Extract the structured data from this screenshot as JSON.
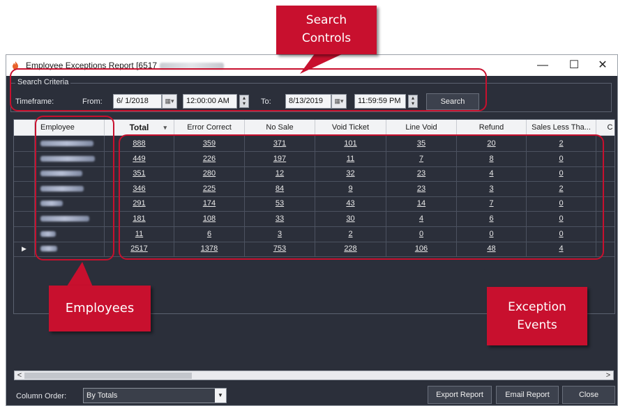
{
  "window": {
    "title": "Employee Exceptions Report [6517",
    "title_suffix_redacted": "- Jacksonville, FL]",
    "minimize": "—",
    "maximize": "☐",
    "close": "✕"
  },
  "criteria": {
    "legend": "Search Criteria",
    "timeframe_label": "Timeframe:",
    "from_label": "From:",
    "from_date": "6/ 1/2018",
    "from_time": "12:00:00 AM",
    "to_label": "To:",
    "to_date": "8/13/2019",
    "to_time": "11:59:59 PM",
    "search_button": "Search"
  },
  "grid": {
    "columns": [
      "Employee",
      "Total",
      "Error Correct",
      "No Sale",
      "Void Ticket",
      "Line Void",
      "Refund",
      "Sales Less Tha...",
      "C"
    ],
    "rows": [
      {
        "values": [
          "888",
          "359",
          "371",
          "101",
          "35",
          "20",
          "2"
        ]
      },
      {
        "values": [
          "449",
          "226",
          "197",
          "11",
          "7",
          "8",
          "0"
        ]
      },
      {
        "values": [
          "351",
          "280",
          "12",
          "32",
          "23",
          "4",
          "0"
        ]
      },
      {
        "values": [
          "346",
          "225",
          "84",
          "9",
          "23",
          "3",
          "2"
        ]
      },
      {
        "values": [
          "291",
          "174",
          "53",
          "43",
          "14",
          "7",
          "0"
        ]
      },
      {
        "values": [
          "181",
          "108",
          "33",
          "30",
          "4",
          "6",
          "0"
        ]
      },
      {
        "values": [
          "11",
          "6",
          "3",
          "2",
          "0",
          "0",
          "0"
        ]
      },
      {
        "values": [
          "2517",
          "1378",
          "753",
          "228",
          "106",
          "48",
          "4"
        ]
      }
    ],
    "current_row_marker": "▶"
  },
  "footer": {
    "column_order_label": "Column Order:",
    "column_order_value": "By Totals",
    "export_button": "Export Report",
    "email_button": "Email Report",
    "close_button": "Close"
  },
  "callouts": {
    "search_controls_line1": "Search",
    "search_controls_line2": "Controls",
    "employees": "Employees",
    "exception_events_line1": "Exception",
    "exception_events_line2": "Events"
  },
  "colors": {
    "accent_red": "#c8102e",
    "window_bg": "#2b2f3a"
  },
  "icons": {
    "app": "flame-person-icon",
    "calendar": "calendar-icon",
    "spinner": "spin-updown-icon"
  }
}
